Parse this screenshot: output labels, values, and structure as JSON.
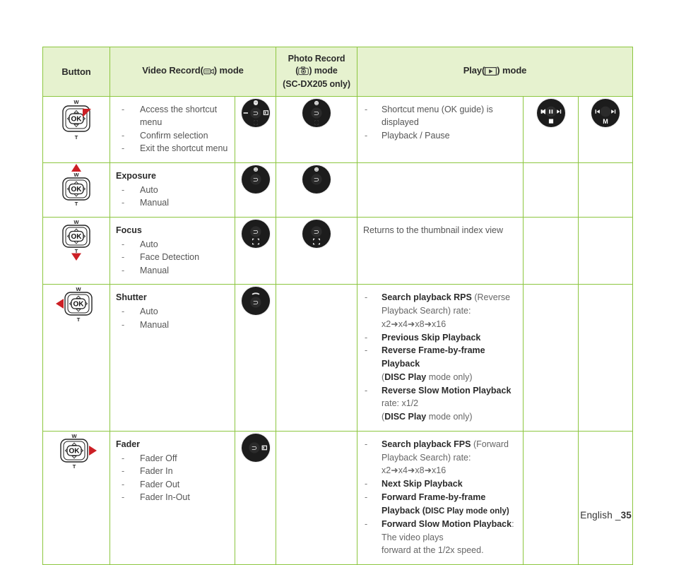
{
  "page": {
    "footer_label": "English _",
    "footer_page": "35",
    "background": "#ffffff",
    "accent_border": "#8cc63f",
    "header_fill": "#e6f2cf"
  },
  "table": {
    "headers": {
      "button": "Button",
      "video_record_pre": "Video Record(",
      "video_record_post": ") mode",
      "video_record_icon": "camcorder-icon",
      "photo_record_line1": "Photo Record",
      "photo_record_pre": "(",
      "photo_record_post": ") mode",
      "photo_record_icon": "camera-icon",
      "photo_record_line3": "(SC-DX205 only)",
      "play_pre": "Play(",
      "play_post": ") mode",
      "play_icon": "play-triangle-icon"
    },
    "rows": [
      {
        "id": "ok-center",
        "button_icon": "joypad-ok-center",
        "video": {
          "title": "",
          "items": [
            "Access the shortcut menu",
            "Confirm selection",
            "Exit the shortcut menu"
          ]
        },
        "video_icon": "dial-shortcut-icon",
        "photo_icon": "dial-shortcut-photo-icon",
        "play": {
          "items": [
            [
              {
                "t": "Shortcut menu (OK guide) is displayed",
                "b": false
              }
            ],
            [
              {
                "t": "Playback / Pause",
                "b": false
              }
            ]
          ]
        },
        "play_icon_1": "transport-prev-pause-next-stop-icon",
        "play_icon_2": "transport-prev-next-mode-icon"
      },
      {
        "id": "exposure",
        "button_icon": "joypad-up",
        "video": {
          "title": "Exposure",
          "items": [
            "Auto",
            "Manual"
          ]
        },
        "video_icon": "dial-exposure-icon",
        "photo_icon": "dial-exposure-photo-icon",
        "play": {
          "items": []
        },
        "play_icon_1": "",
        "play_icon_2": ""
      },
      {
        "id": "focus",
        "button_icon": "joypad-down",
        "video": {
          "title": "Focus",
          "items": [
            "Auto",
            "Face Detection",
            "Manual"
          ]
        },
        "video_icon": "dial-focus-icon",
        "photo_icon": "dial-focus-photo-icon",
        "play_flat": "Returns to the thumbnail index view",
        "play_icon_1": "",
        "play_icon_2": ""
      },
      {
        "id": "shutter",
        "button_icon": "joypad-left",
        "video": {
          "title": "Shutter",
          "items": [
            "Auto",
            "Manual"
          ]
        },
        "video_icon": "dial-shutter-icon",
        "photo_icon": "",
        "play": {
          "items": [
            [
              {
                "t": "Search playback RPS",
                "b": true
              },
              {
                "t": " (Reverse Playback Search) rate:",
                "b": false
              },
              {
                "t": "\nx2➜x4➜x8➜x16",
                "b": false
              }
            ],
            [
              {
                "t": "Previous Skip Playback",
                "b": true
              }
            ],
            [
              {
                "t": "Reverse Frame-by-frame Playback",
                "b": true
              },
              {
                "t": "\n(",
                "b": false
              },
              {
                "t": "DISC Play",
                "b": true
              },
              {
                "t": " mode only)",
                "b": false
              }
            ],
            [
              {
                "t": "Reverse Slow Motion Playback",
                "b": true
              },
              {
                "t": " rate: x1/2",
                "b": false
              },
              {
                "t": "\n(",
                "b": false
              },
              {
                "t": "DISC Play",
                "b": true
              },
              {
                "t": " mode only)",
                "b": false
              }
            ]
          ]
        },
        "play_icon_1": "",
        "play_icon_2": ""
      },
      {
        "id": "fader",
        "button_icon": "joypad-right",
        "video": {
          "title": "Fader",
          "items": [
            "Fader Off",
            "Fader In",
            "Fader Out",
            "Fader In-Out"
          ]
        },
        "video_icon": "dial-fader-icon",
        "photo_icon": "",
        "play": {
          "items": [
            [
              {
                "t": "Search playback FPS",
                "b": true
              },
              {
                "t": " (Forward Playback Search) rate:",
                "b": false
              },
              {
                "t": "\nx2➜x4➜x8➜x16",
                "b": false
              }
            ],
            [
              {
                "t": "Next Skip Playback",
                "b": true
              }
            ],
            [
              {
                "t": "Forward Frame-by-frame Playback",
                "b": true
              },
              {
                "t": " (",
                "b": false
              },
              {
                "t": "DISC Play mode only)",
                "b": true
              }
            ],
            [
              {
                "t": "Forward Slow Motion Playback",
                "b": true
              },
              {
                "t": ": The video plays",
                "b": false
              },
              {
                "t": "\nforward at the 1/2x speed.",
                "b": false
              }
            ]
          ]
        },
        "play_icon_1": "",
        "play_icon_2": ""
      }
    ]
  }
}
